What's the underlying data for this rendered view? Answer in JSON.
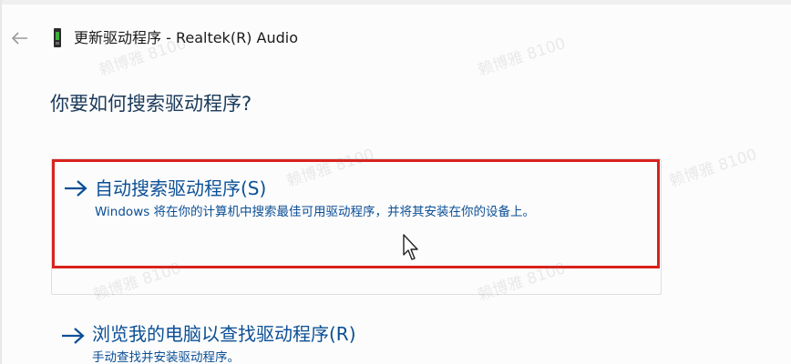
{
  "window": {
    "title": "更新驱动程序 - Realtek(R) Audio",
    "back_icon": "back-arrow-icon",
    "device_icon": "audio-device-icon"
  },
  "heading": "你要如何搜索驱动程序?",
  "options": [
    {
      "title": "自动搜索驱动程序(S)",
      "description": "Windows 将在你的计算机中搜索最佳可用驱动程序，并将其安装在你的设备上。",
      "icon": "arrow-right-icon",
      "highlight_color": "#d9231d"
    },
    {
      "title": "浏览我的电脑以查找驱动程序(R)",
      "description": "手动查找并安装驱动程序。",
      "icon": "arrow-right-icon"
    }
  ],
  "watermark": "赖博雅 8100",
  "colors": {
    "link": "#0b4f95",
    "heading": "#1b3a5a",
    "highlight": "#d9231d"
  }
}
